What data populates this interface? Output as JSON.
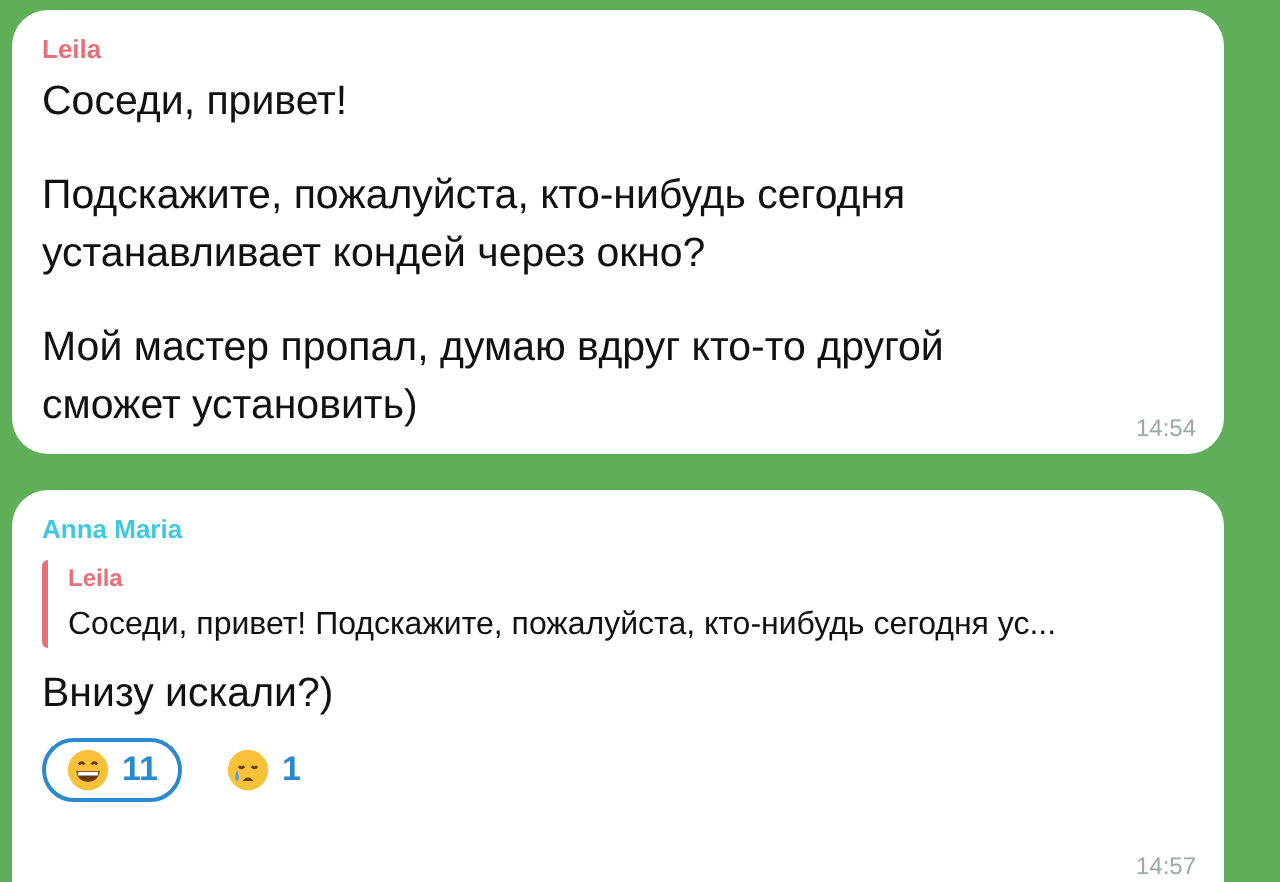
{
  "messages": [
    {
      "sender": "Leila",
      "color": "#e8707a",
      "paragraphs": [
        "Соседи, привет!",
        "Подскажите, пожалуйста, кто-нибудь сегодня устанавливает кондей через окно?",
        "Мой мастер пропал, думаю вдруг кто-то другой сможет установить)"
      ],
      "time": "14:54"
    },
    {
      "sender": "Anna Maria",
      "color": "#3fc8e0",
      "reply": {
        "sender": "Leila",
        "color": "#e8707a",
        "text": "Соседи, привет! Подскажите, пожалуйста, кто-нибудь сегодня ус..."
      },
      "paragraphs": [
        "Внизу искали?)"
      ],
      "reactions": [
        {
          "kind": "grin",
          "count": "11",
          "selected": true
        },
        {
          "kind": "cry",
          "count": "1",
          "selected": false
        }
      ],
      "time": "14:57"
    }
  ]
}
